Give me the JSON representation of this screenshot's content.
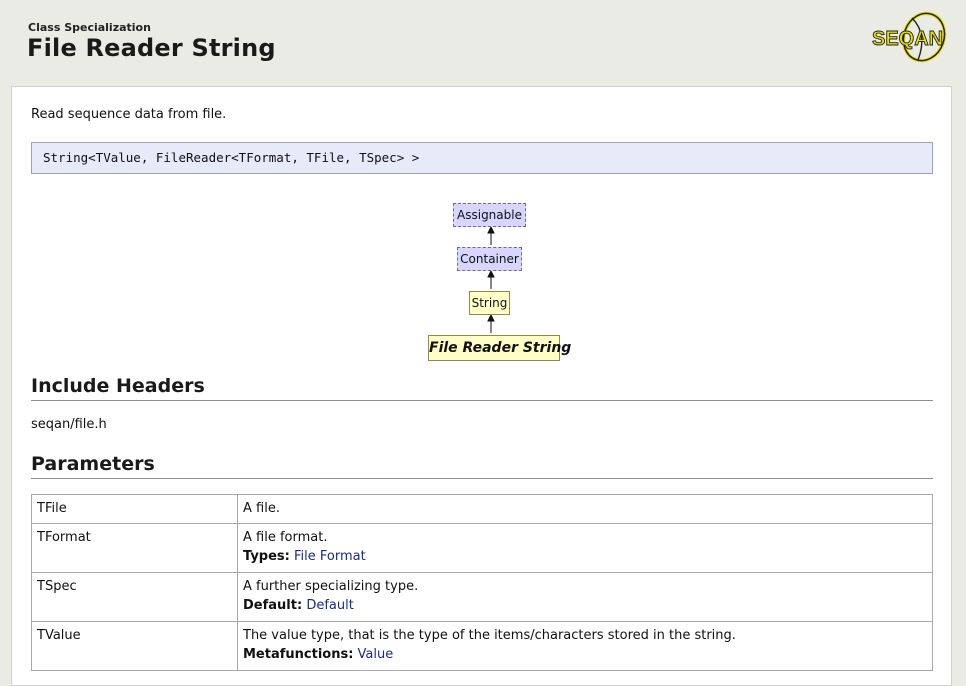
{
  "header": {
    "kind": "Class Specialization",
    "title": "File Reader String",
    "logo_text": "SEQAN"
  },
  "summary": "Read sequence data from file.",
  "signature": "String<TValue, FileReader<TFormat, TFile, TSpec> >",
  "hierarchy": {
    "nodes": [
      "Assignable",
      "Container",
      "String",
      "File Reader String"
    ]
  },
  "include_headers": {
    "heading": "Include Headers",
    "value": "seqan/file.h"
  },
  "parameters": {
    "heading": "Parameters",
    "rows": [
      {
        "name": "TFile",
        "desc": "A file.",
        "meta_label": "",
        "meta_link": ""
      },
      {
        "name": "TFormat",
        "desc": "A file format.",
        "meta_label": "Types:",
        "meta_link": "File Format"
      },
      {
        "name": "TSpec",
        "desc": "A further specializing type.",
        "meta_label": "Default:",
        "meta_link": "Default"
      },
      {
        "name": "TValue",
        "desc": "The value type, that is the type of the items/characters stored in the string.",
        "meta_label": "Metafunctions:",
        "meta_link": "Value"
      }
    ]
  },
  "colors": {
    "abstract_fill": "#d8d6ff",
    "concrete_fill": "#ffffc6",
    "signature_fill": "#e6eaf9",
    "link": "#1a2b8f",
    "logo_yellow": "#e8e000"
  }
}
